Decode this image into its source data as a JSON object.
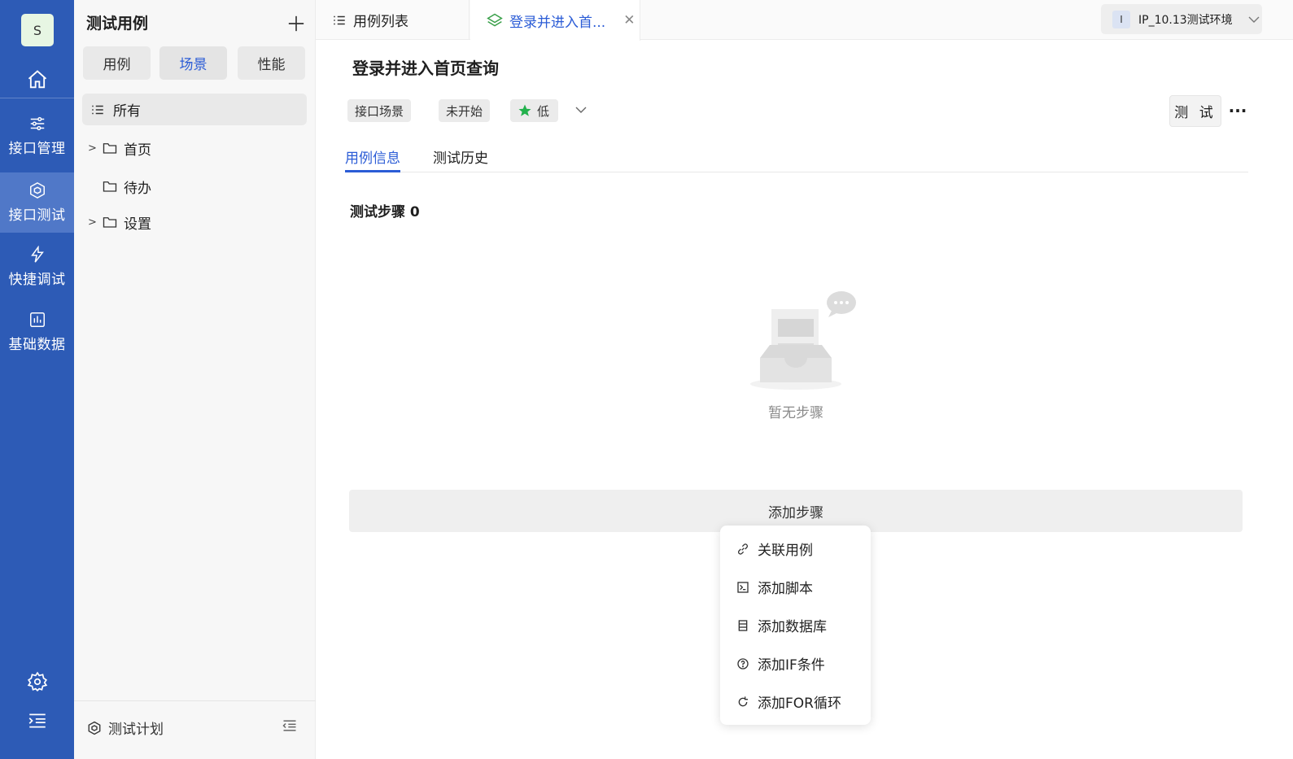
{
  "rail": {
    "avatar_letter": "S",
    "items": [
      {
        "label": "接口管理",
        "icon": "sliders-icon"
      },
      {
        "label": "接口测试",
        "icon": "cube-icon"
      },
      {
        "label": "快捷调试",
        "icon": "lightning-icon"
      },
      {
        "label": "基础数据",
        "icon": "chart-box-icon"
      }
    ]
  },
  "tree": {
    "title": "测试用例",
    "segments": [
      "用例",
      "场景",
      "性能"
    ],
    "all_label": "所有",
    "nodes": [
      {
        "label": "首页",
        "expandable": true
      },
      {
        "label": "待办",
        "expandable": false
      },
      {
        "label": "设置",
        "expandable": true
      }
    ],
    "footer_label": "测试计划"
  },
  "tabs": {
    "list_tab": "用例列表",
    "case_tab": "登录并进入首..."
  },
  "env": {
    "badge": "I",
    "label": "IP_10.13测试环境"
  },
  "case": {
    "title": "登录并进入首页查询",
    "type_tag": "接口场景",
    "status_tag": "未开始",
    "priority": "低",
    "test_button": "测 试",
    "subtabs": [
      "用例信息",
      "测试历史"
    ],
    "steps_title": "测试步骤 0",
    "empty_text": "暂无步骤",
    "add_step": "添加步骤"
  },
  "menu": {
    "items": [
      {
        "label": "关联用例",
        "icon": "link-icon"
      },
      {
        "label": "添加脚本",
        "icon": "terminal-icon"
      },
      {
        "label": "添加数据库",
        "icon": "database-icon"
      },
      {
        "label": "添加IF条件",
        "icon": "question-circle-icon"
      },
      {
        "label": "添加FOR循环",
        "icon": "loop-icon"
      }
    ]
  },
  "colors": {
    "rail_bg": "#2d5bb6",
    "accent": "#2b5cd6",
    "priority_star": "#22b14c"
  }
}
